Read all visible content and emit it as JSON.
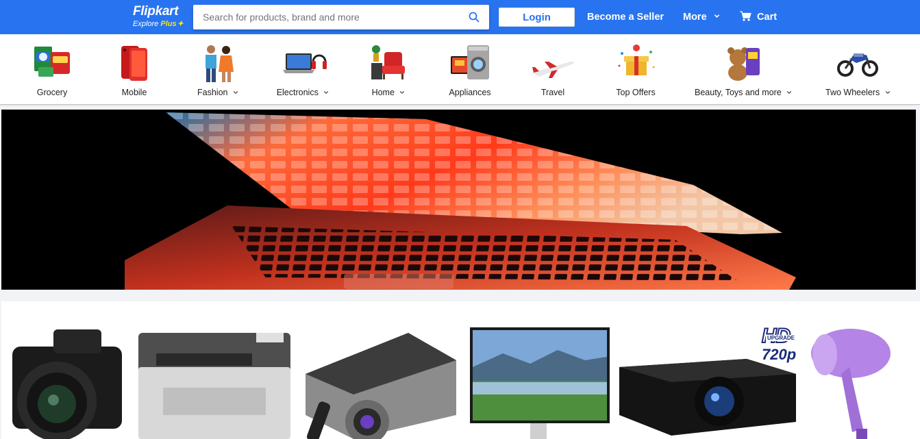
{
  "header": {
    "logo_text": "Flipkart",
    "logo_sub_explore": "Explore",
    "logo_sub_plus": "Plus",
    "search_placeholder": "Search for products, brand and more",
    "login_label": "Login",
    "seller_label": "Become a Seller",
    "more_label": "More",
    "cart_label": "Cart",
    "colors": {
      "brand_blue": "#2874f0",
      "accent_yellow": "#ffe500"
    }
  },
  "categories": [
    {
      "label": "Grocery",
      "has_dropdown": false,
      "icon": "grocery-icon"
    },
    {
      "label": "Mobile",
      "has_dropdown": false,
      "icon": "mobile-icon"
    },
    {
      "label": "Fashion",
      "has_dropdown": true,
      "icon": "fashion-icon"
    },
    {
      "label": "Electronics",
      "has_dropdown": true,
      "icon": "electronics-icon"
    },
    {
      "label": "Home",
      "has_dropdown": true,
      "icon": "home-icon"
    },
    {
      "label": "Appliances",
      "has_dropdown": false,
      "icon": "appliances-icon"
    },
    {
      "label": "Travel",
      "has_dropdown": false,
      "icon": "travel-icon"
    },
    {
      "label": "Top Offers",
      "has_dropdown": false,
      "icon": "top-offers-icon"
    },
    {
      "label": "Beauty, Toys and more",
      "has_dropdown": true,
      "icon": "beauty-toys-icon"
    },
    {
      "label": "Two Wheelers",
      "has_dropdown": true,
      "icon": "two-wheelers-icon"
    }
  ],
  "banner": {
    "image": "laptop-keyboard-banner"
  },
  "products": [
    {
      "image": "camera-image"
    },
    {
      "image": "printer-image"
    },
    {
      "image": "projector-image"
    },
    {
      "image": "monitor-image"
    },
    {
      "image": "hd-projector-image",
      "badge_top": "UPGRADE",
      "badge_hd": "HD",
      "badge_res": "720p"
    },
    {
      "image": "hair-dryer-image"
    }
  ]
}
